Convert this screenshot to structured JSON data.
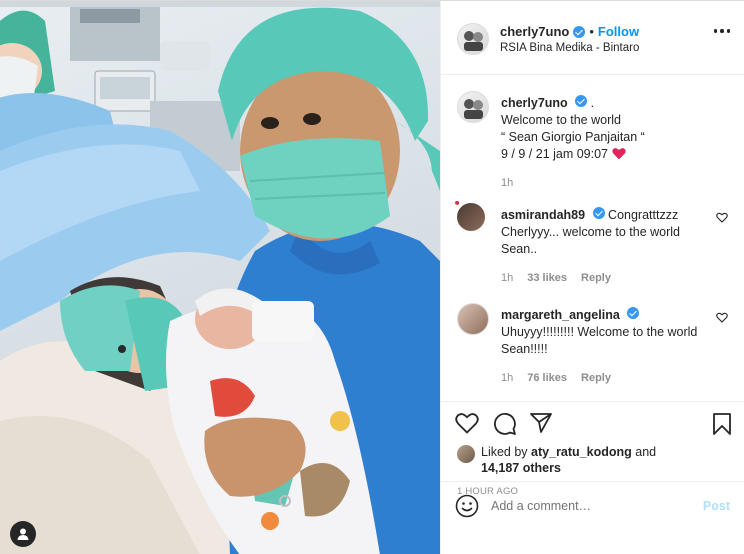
{
  "post": {
    "username": "cherly7uno",
    "follow_label": "Follow",
    "separator": "•",
    "location": "RSIA Bina Medika - Bintaro",
    "caption": {
      "username": "cherly7uno",
      "after_name": ".",
      "lines": [
        "Welcome to the world",
        "“ Sean Giorgio Panjaitan “",
        "9 / 9 / 21 jam 09:07"
      ],
      "emoji": "red-heart-emoji",
      "time": "1h"
    },
    "comments": [
      {
        "username": "asmirandah89",
        "verified": true,
        "text": "Congratttzzz Cherlyyy... welcome to the world Sean..",
        "time": "1h",
        "likes": "33 likes",
        "reply": "Reply"
      },
      {
        "username": "margareth_angelina",
        "verified": true,
        "text": "Uhuyyy!!!!!!!!! Welcome to the world Sean!!!!!",
        "time": "1h",
        "likes": "76 likes",
        "reply": "Reply"
      }
    ],
    "liked_by_prefix": "Liked by",
    "liked_by_user": "aty_ratu_kodong",
    "liked_by_and": "and",
    "liked_by_others": "14,187 others",
    "time_ago": "1 HOUR AGO",
    "comment_placeholder": "Add a comment…",
    "post_label": "Post"
  },
  "colors": {
    "accent": "#0095f6",
    "verified": "#3897f0",
    "heart": "#ed4956",
    "scrub": "#2f7fd1",
    "cap": "#58c9b9"
  }
}
